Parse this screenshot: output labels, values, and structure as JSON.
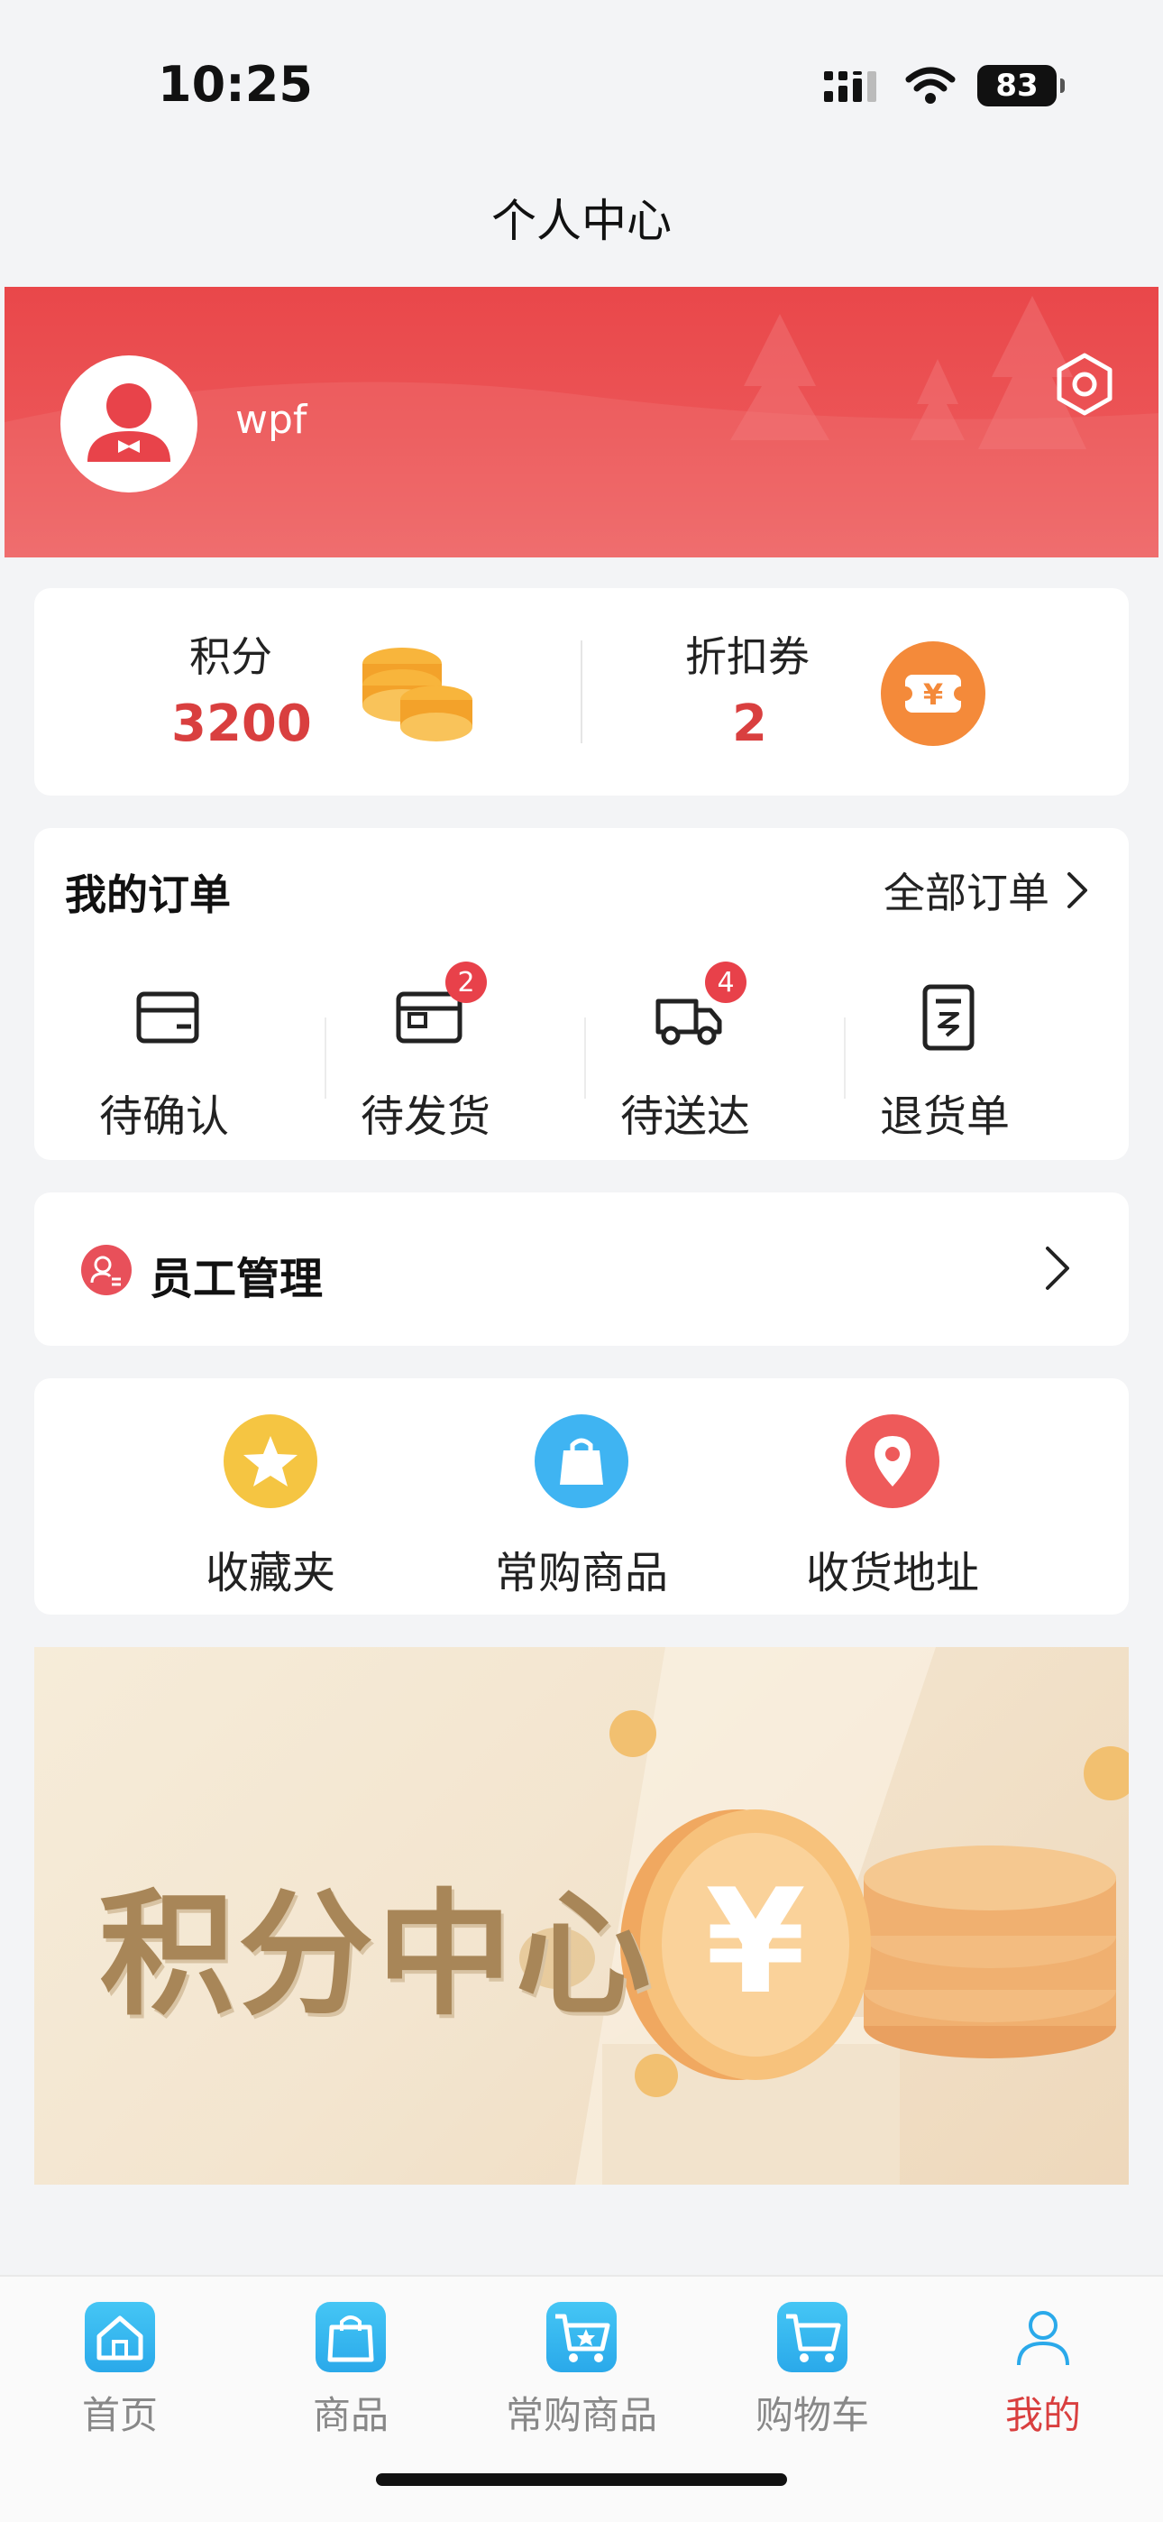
{
  "status_bar": {
    "time": "10:25",
    "battery": "83"
  },
  "nav": {
    "title": "个人中心"
  },
  "profile": {
    "username": "wpf"
  },
  "stats": {
    "points_label": "积分",
    "points_value": "3200",
    "coupons_label": "折扣券",
    "coupons_value": "2"
  },
  "orders": {
    "title": "我的订单",
    "all_label": "全部订单",
    "items": [
      {
        "label": "待确认",
        "icon": "wallet-icon",
        "badge": ""
      },
      {
        "label": "待发货",
        "icon": "package-icon",
        "badge": "2"
      },
      {
        "label": "待送达",
        "icon": "truck-icon",
        "badge": "4"
      },
      {
        "label": "退货单",
        "icon": "receipt-icon",
        "badge": ""
      }
    ]
  },
  "staff": {
    "label": "员工管理"
  },
  "quick_links": [
    {
      "label": "收藏夹",
      "icon": "star-icon",
      "color": "#f5c542"
    },
    {
      "label": "常购商品",
      "icon": "shopping-bag-icon",
      "color": "#3fb4f2"
    },
    {
      "label": "收货地址",
      "icon": "location-pin-icon",
      "color": "#ee5a5a"
    }
  ],
  "promo": {
    "title": "积分中心"
  },
  "tabs": [
    {
      "label": "首页",
      "icon": "home-icon"
    },
    {
      "label": "商品",
      "icon": "bag-icon"
    },
    {
      "label": "常购商品",
      "icon": "cart-star-icon"
    },
    {
      "label": "购物车",
      "icon": "cart-icon"
    },
    {
      "label": "我的",
      "icon": "user-icon",
      "active": true
    }
  ],
  "colors": {
    "brand_red": "#e9474a",
    "accent_red": "#d93f3f",
    "tab_blue": "#2aa9ea"
  }
}
